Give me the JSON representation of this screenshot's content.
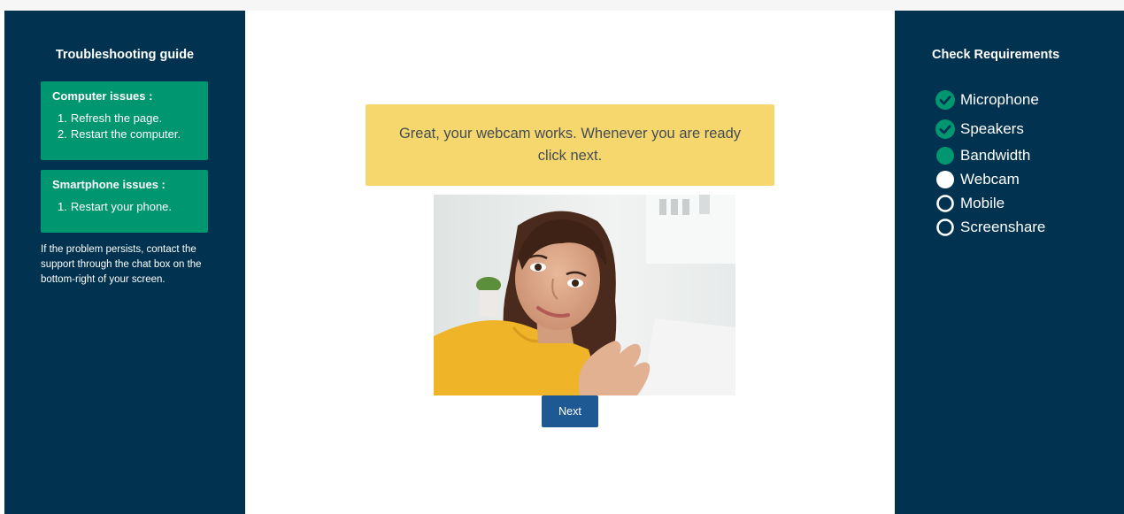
{
  "left_sidebar": {
    "title": "Troubleshooting guide",
    "computer_issues": {
      "title": "Computer issues :",
      "items": [
        "Refresh the page.",
        "Restart the computer."
      ]
    },
    "smartphone_issues": {
      "title": "Smartphone issues :",
      "items": [
        "Restart your phone."
      ]
    },
    "help_text": "If the problem persists, contact the support through the chat box on the bottom-right of your screen."
  },
  "main": {
    "banner_text": "Great, your webcam works. Whenever you are ready click next.",
    "next_label": "Next"
  },
  "right_sidebar": {
    "title": "Check Requirements",
    "requirements": [
      {
        "label": "Microphone",
        "status": "done",
        "icon": "check-circle-icon"
      },
      {
        "label": "Speakers",
        "status": "done",
        "icon": "check-circle-icon"
      },
      {
        "label": "Bandwidth",
        "status": "in-progress",
        "icon": "filled-circle-icon"
      },
      {
        "label": "Webcam",
        "status": "current",
        "icon": "white-circle-icon"
      },
      {
        "label": "Mobile",
        "status": "pending",
        "icon": "empty-circle-icon"
      },
      {
        "label": "Screenshare",
        "status": "pending",
        "icon": "empty-circle-icon"
      }
    ]
  },
  "colors": {
    "sidebar_bg": "#01324f",
    "card_green": "#009670",
    "banner_yellow": "#f5d76e",
    "button_blue": "#1f5993"
  }
}
